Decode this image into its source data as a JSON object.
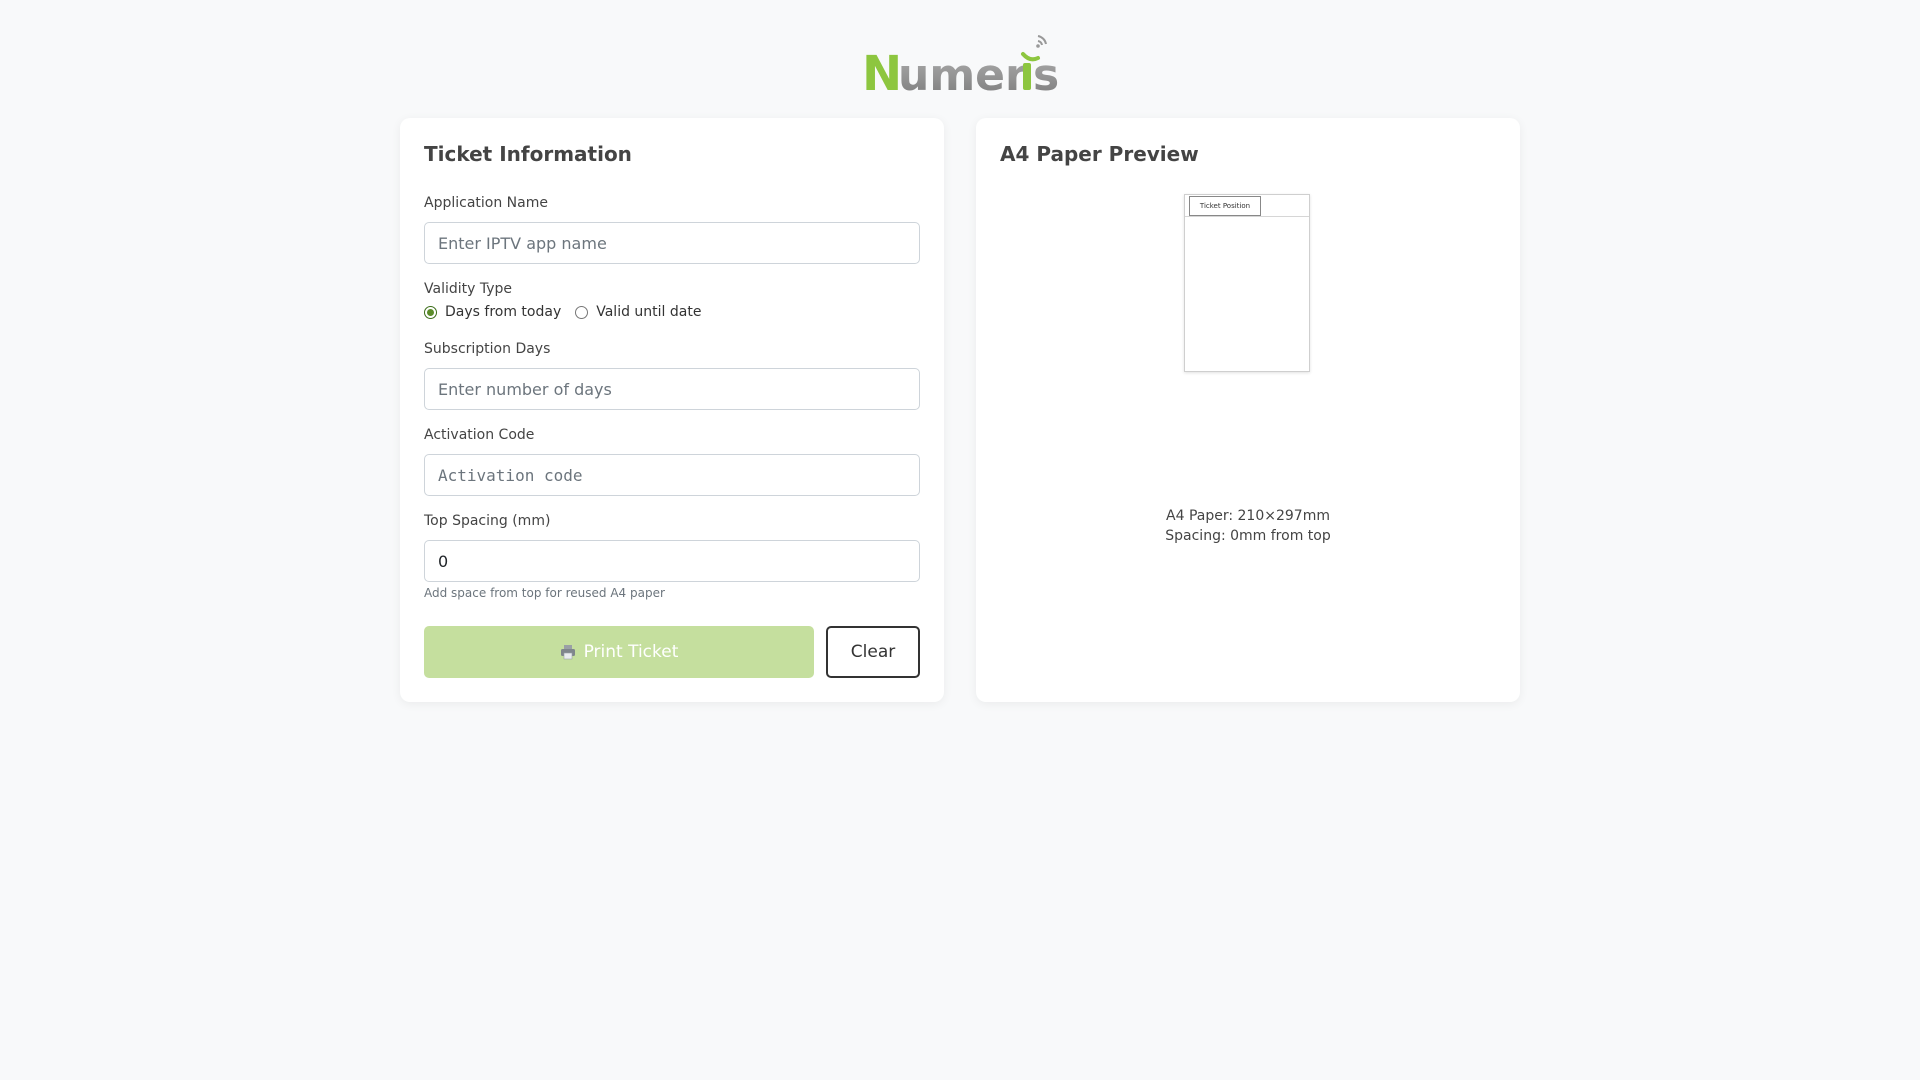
{
  "brand": {
    "logo_text": "Numeris",
    "colors": {
      "green": "#8dc63f",
      "gray": "#8a8a8a"
    }
  },
  "form": {
    "title": "Ticket Information",
    "app_name": {
      "label": "Application Name",
      "placeholder": "Enter IPTV app name",
      "value": ""
    },
    "validity": {
      "label": "Validity Type",
      "options": [
        "Days from today",
        "Valid until date"
      ],
      "selected": "Days from today"
    },
    "days": {
      "label": "Subscription Days",
      "placeholder": "Enter number of days",
      "value": ""
    },
    "activation": {
      "label": "Activation Code",
      "placeholder": "Activation code",
      "value": ""
    },
    "spacing": {
      "label": "Top Spacing (mm)",
      "value": "0",
      "hint": "Add space from top for reused A4 paper"
    },
    "buttons": {
      "print": "Print Ticket",
      "clear": "Clear"
    }
  },
  "preview": {
    "title": "A4 Paper Preview",
    "ticket_label": "Ticket Position",
    "paper_size": "A4 Paper: 210×297mm",
    "spacing_text": "Spacing: 0mm from top"
  }
}
